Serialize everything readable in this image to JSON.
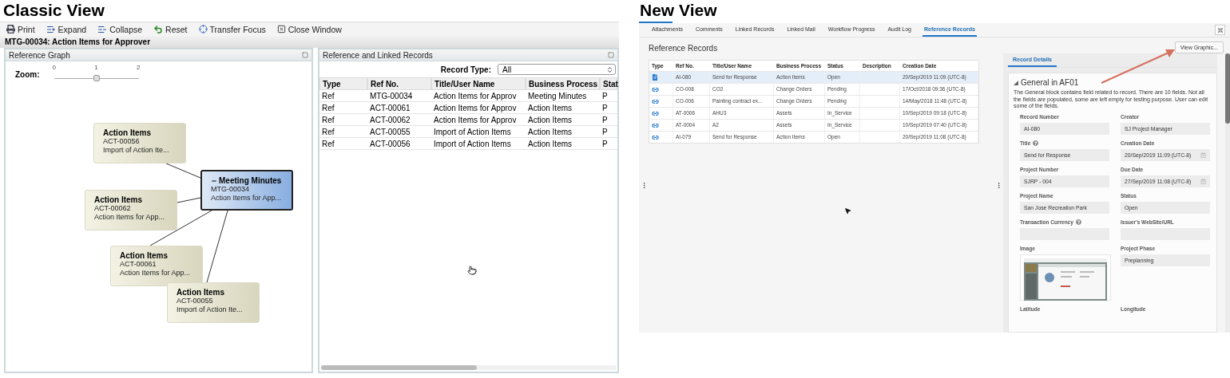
{
  "classic_view": {
    "heading": "Classic View",
    "toolbar": [
      {
        "kind": "print",
        "label": "Print"
      },
      {
        "kind": "expand",
        "label": "Expand"
      },
      {
        "kind": "collapse",
        "label": "Collapse"
      },
      {
        "kind": "reset",
        "label": "Reset"
      },
      {
        "kind": "focus",
        "label": "Transfer Focus"
      },
      {
        "kind": "close",
        "label": "Close Window"
      }
    ],
    "record_title": "MTG-00034: Action Items for Approver",
    "reference_graph": {
      "title": "Reference Graph",
      "zoom": {
        "label": "Zoom:",
        "ticks": [
          "0",
          "1",
          "2"
        ],
        "level": 0.5
      },
      "focus_node": {
        "expanded": true,
        "type": "Meeting Minutes",
        "ref": "MTG-00034",
        "title": "Action Items for App..."
      },
      "linked_nodes": [
        {
          "type": "Action Items",
          "ref": "ACT-00056",
          "title": "Import of Action Ite..."
        },
        {
          "type": "Action Items",
          "ref": "ACT-00062",
          "title": "Action Items for App..."
        },
        {
          "type": "Action Items",
          "ref": "ACT-00061",
          "title": "Action Items for App..."
        },
        {
          "type": "Action Items",
          "ref": "ACT-00055",
          "title": "Import of Action Ite..."
        }
      ]
    },
    "records_panel": {
      "title": "Reference and Linked Records",
      "record_type": {
        "label": "Record Type:",
        "value": "All"
      },
      "columns": [
        "Type",
        "Ref No.",
        "Title/User Name",
        "Business Process",
        "Stat"
      ],
      "rows": [
        [
          "Ref",
          "MTG-00034",
          "Action Items for Approv",
          "Meeting Minutes",
          "P"
        ],
        [
          "Ref",
          "ACT-00061",
          "Action Items for Approv",
          "Action Items",
          "P"
        ],
        [
          "Ref",
          "ACT-00062",
          "Action Items for Approv",
          "Action Items",
          "P"
        ],
        [
          "Ref",
          "ACT-00055",
          "Import of Action Items",
          "Action Items",
          "P"
        ],
        [
          "Ref",
          "ACT-00056",
          "Import of Action Items",
          "Action Items",
          "P"
        ]
      ]
    }
  },
  "new_view": {
    "heading": "New View",
    "tabs": [
      {
        "label": "Attachments",
        "selected": false
      },
      {
        "label": "Comments",
        "selected": false
      },
      {
        "label": "Linked Records",
        "selected": false
      },
      {
        "label": "Linked Mail",
        "selected": false
      },
      {
        "label": "Workflow Progress",
        "selected": false
      },
      {
        "label": "Audit Log",
        "selected": false
      },
      {
        "label": "Reference Records",
        "selected": true
      }
    ],
    "section_title": "Reference Records",
    "table": {
      "columns": [
        "Type",
        "Ref No.",
        "Title/User Name",
        "Business Process",
        "Status",
        "Description",
        "Creation Date"
      ],
      "rows": [
        {
          "kind": "document",
          "selected": true,
          "ref": "AI-080",
          "title": "Send for Response",
          "process": "Action Items",
          "status": "Open",
          "created": "20/Sep/2019 11:09 (UTC-8)"
        },
        {
          "kind": "link",
          "selected": false,
          "ref": "CO-008",
          "title": "CO2",
          "process": "Change Orders",
          "status": "Pending",
          "created": "17/Oct/2018 09:36 (UTC-8)"
        },
        {
          "kind": "link",
          "selected": false,
          "ref": "CO-006",
          "title": "Painting contract ex...",
          "process": "Change Orders",
          "status": "Pending",
          "created": "14/May/2018 11:48 (UTC-8)"
        },
        {
          "kind": "link",
          "selected": false,
          "ref": "AT-0006",
          "title": "AHU3",
          "process": "Assets",
          "status": "In_Service",
          "created": "10/Sep/2019 09:18 (UTC-8)"
        },
        {
          "kind": "link",
          "selected": false,
          "ref": "AT-0004",
          "title": "A2",
          "process": "Assets",
          "status": "In_Service",
          "created": "10/Sep/2019 07:40 (UTC-8)"
        },
        {
          "kind": "link",
          "selected": false,
          "ref": "AI-079",
          "title": "Send for Response",
          "process": "Action Items",
          "status": "Open",
          "created": "20/Sep/2019 11:08 (UTC-8)"
        }
      ]
    },
    "view_graphic_button": "View Graphic...",
    "details_tab": {
      "label": "Record Details",
      "selected": true
    },
    "block": {
      "title": "General in AF01",
      "expanded": true,
      "description": "The General block contains field related to record. There are 10 fields. Not all the fields are populated, some are left empty for testing purpose. User can edit some of the fields.",
      "fields": [
        {
          "kind": "text",
          "label": "Record Number",
          "help": false,
          "value": "AI-080"
        },
        {
          "kind": "text",
          "label": "Creator",
          "help": false,
          "value": "SJ Project Manager"
        },
        {
          "kind": "text",
          "label": "Title",
          "help": true,
          "value": "Send for Response"
        },
        {
          "kind": "date",
          "label": "Creation Date",
          "help": false,
          "value": "20/Sep/2019 11:09  (UTC-8)"
        },
        {
          "kind": "text",
          "label": "Project Number",
          "help": false,
          "value": "SJRP - 004"
        },
        {
          "kind": "date",
          "label": "Due Date",
          "help": false,
          "value": "27/Sep/2019 11:08  (UTC-8)"
        },
        {
          "kind": "text",
          "label": "Project Name",
          "help": false,
          "value": "San Jose Recreation Park"
        },
        {
          "kind": "text",
          "label": "Status",
          "help": false,
          "value": "Open"
        },
        {
          "kind": "text",
          "label": "Transaction Currency",
          "help": true
        },
        {
          "kind": "text",
          "label": "Issuer's WebSite/URL",
          "help": false
        },
        {
          "label": "Image",
          "help": false
        },
        {
          "kind": "text",
          "label": "Project Phase",
          "help": false,
          "value": "Preplanning"
        },
        {
          "kind": "label",
          "label": "Latitude",
          "help": false
        },
        {
          "kind": "label",
          "label": "Longitude",
          "help": false
        }
      ]
    }
  }
}
